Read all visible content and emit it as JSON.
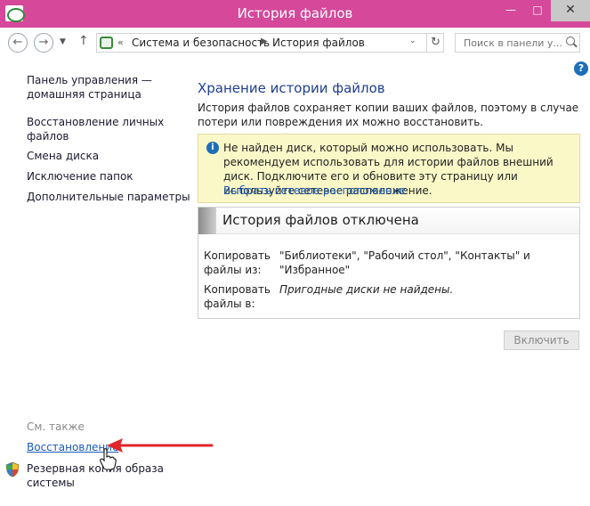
{
  "window": {
    "title": "История файлов",
    "min_glyph": "—",
    "max_glyph": "□",
    "close_glyph": "✕"
  },
  "toolbar": {
    "back_glyph": "←",
    "forward_glyph": "→",
    "dropdown_glyph": "▼",
    "up_glyph": "↑",
    "address": {
      "separator": "«",
      "crumbs": [
        "Система и безопасность",
        "История файлов"
      ],
      "crumb_arrow": "▶",
      "dropdown_glyph": "⌄",
      "refresh_glyph": "↻"
    },
    "search_placeholder": "Поиск в панели у..."
  },
  "help_glyph": "?",
  "sidebar": {
    "home_link": [
      "Панель управления —",
      "домашняя страница"
    ],
    "items": [
      [
        "Восстановление личных",
        "файлов"
      ],
      [
        "Смена диска"
      ],
      [
        "Исключение папок"
      ],
      [
        "Дополнительные параметры"
      ]
    ],
    "see_also": "См. также",
    "restore_link": "Восстановление",
    "backup_link": [
      "Резервная копия образа",
      "системы"
    ]
  },
  "main": {
    "title": "Хранение истории файлов",
    "description": "История файлов сохраняет копии ваших файлов, поэтому в случае потери или повреждения их можно восстановить.",
    "notice": {
      "info_glyph": "i",
      "text": "Не найден диск, который можно использовать. Мы рекомендуем использовать для истории файлов внешний диск. Подключите его и обновите эту страницу или используйте сетевое расположение.",
      "link": "Выбрать сетевое расположение"
    },
    "status_panel": {
      "title": "История файлов отключена",
      "copy_from_label": [
        "Копировать",
        "файлы из:"
      ],
      "copy_from_value": "\"Библиотеки\", \"Рабочий стол\", \"Контакты\" и \"Избранное\"",
      "copy_to_label": [
        "Копировать",
        "файлы в:"
      ],
      "copy_to_value": "Пригодные диски не найдены."
    },
    "enable_button": "Включить"
  },
  "colors": {
    "titlebar": "#d5489a",
    "link": "#1a5bb5",
    "heading": "#1e3f8f",
    "notice_bg": "#fbf8c8",
    "annotation_arrow": "#e0262a"
  }
}
